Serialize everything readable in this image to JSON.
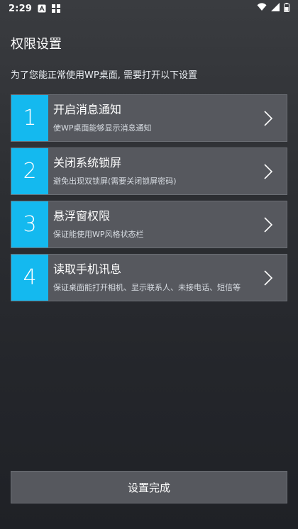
{
  "status_bar": {
    "time": "2:29",
    "icons": [
      "a-icon",
      "grid-icon",
      "wifi-icon",
      "signal-icon",
      "battery-icon"
    ]
  },
  "header": {
    "title": "权限设置",
    "subtitle": "为了您能正常使用WP桌面, 需要打开以下设置"
  },
  "permissions": [
    {
      "number": "1",
      "title": "开启消息通知",
      "description": "使WP桌面能够显示消息通知"
    },
    {
      "number": "2",
      "title": "关闭系统锁屏",
      "description": "避免出现双锁屏(需要关闭锁屏密码)"
    },
    {
      "number": "3",
      "title": "悬浮窗权限",
      "description": "保证能使用WP风格状态栏"
    },
    {
      "number": "4",
      "title": "读取手机讯息",
      "description": "保证桌面能打开相机、显示联系人、未接电话、短信等"
    }
  ],
  "footer": {
    "done_label": "设置完成"
  },
  "colors": {
    "accent": "#14b9ef",
    "card_bg": "#56585e",
    "card_border": "#6b6e74"
  }
}
